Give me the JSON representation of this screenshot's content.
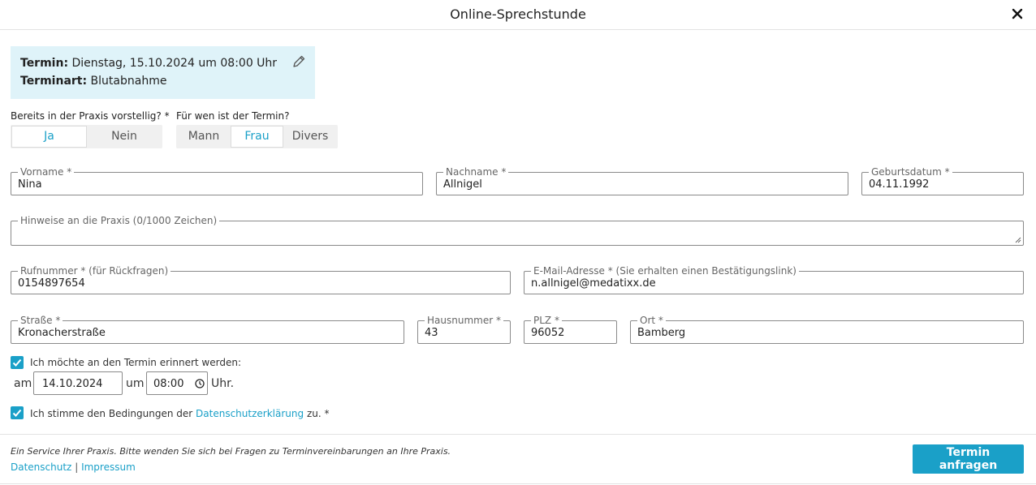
{
  "header": {
    "title": "Online-Sprechstunde"
  },
  "appointment": {
    "termin_label": "Termin:",
    "termin_value": "Dienstag, 15.10.2024 um 08:00 Uhr",
    "type_label": "Terminart:",
    "type_value": "Blutabnahme"
  },
  "question_existing": {
    "label": "Bereits in der Praxis vorstellig? *",
    "options": [
      "Ja",
      "Nein"
    ],
    "selected": "Ja"
  },
  "question_gender": {
    "label": "Für wen ist der Termin?",
    "options": [
      "Mann",
      "Frau",
      "Divers"
    ],
    "selected": "Frau"
  },
  "fields": {
    "vorname": {
      "label": "Vorname *",
      "value": "Nina"
    },
    "nachname": {
      "label": "Nachname *",
      "value": "Allnigel"
    },
    "geburtsdatum": {
      "label": "Geburtsdatum *",
      "value": "04.11.1992"
    },
    "hinweise": {
      "label": "Hinweise an die Praxis (0/1000 Zeichen)",
      "value": ""
    },
    "rufnummer": {
      "label": "Rufnummer * (für Rückfragen)",
      "value": "0154897654"
    },
    "email": {
      "label": "E-Mail-Adresse * (Sie erhalten einen Bestätigungslink)",
      "value": "n.allnigel@medatixx.de"
    },
    "strasse": {
      "label": "Straße *",
      "value": "Kronacherstraße"
    },
    "hausnummer": {
      "label": "Hausnummer *",
      "value": "43"
    },
    "plz": {
      "label": "PLZ *",
      "value": "96052"
    },
    "ort": {
      "label": "Ort *",
      "value": "Bamberg"
    }
  },
  "reminder": {
    "checked": true,
    "label": "Ich möchte an den Termin erinnert werden:",
    "am": "am",
    "date": "14.10.2024",
    "um": "um",
    "time": "08:00",
    "uhr": "Uhr."
  },
  "privacy": {
    "checked": true,
    "text_before": "Ich stimme den Bedingungen der",
    "link": "Datenschutzerklärung",
    "text_after": "zu. *"
  },
  "footer": {
    "note": "Ein Service Ihrer Praxis. Bitte wenden Sie sich bei Fragen zu Terminvereinbarungen an Ihre Praxis.",
    "link_datenschutz": "Datenschutz",
    "separator": "|",
    "link_impressum": "Impressum",
    "submit": "Termin anfragen"
  },
  "colors": {
    "accent": "#1aa0c8",
    "info_bg": "#dff3f9"
  }
}
